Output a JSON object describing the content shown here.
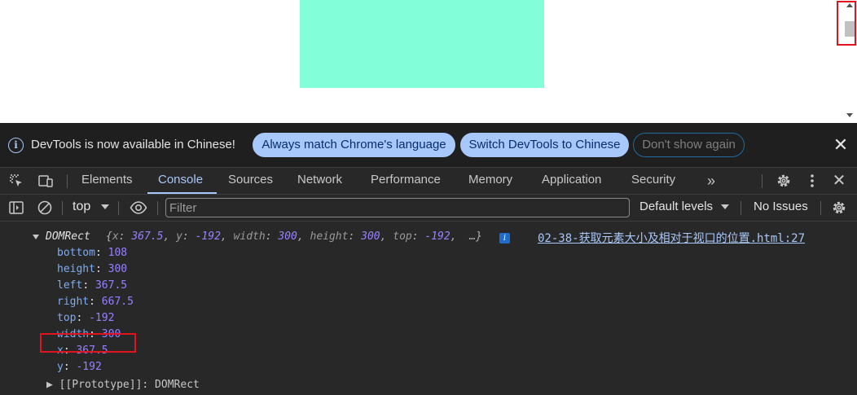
{
  "page": {
    "box_color": "#82ffd9"
  },
  "infobar": {
    "message": "DevTools is now available in Chinese!",
    "match_button": "Always match Chrome's language",
    "switch_button": "Switch DevTools to Chinese",
    "dismiss_button": "Don't show again"
  },
  "tabs": [
    {
      "label": "Elements"
    },
    {
      "label": "Console"
    },
    {
      "label": "Sources"
    },
    {
      "label": "Network"
    },
    {
      "label": "Performance"
    },
    {
      "label": "Memory"
    },
    {
      "label": "Application"
    },
    {
      "label": "Security"
    }
  ],
  "active_tab": "Console",
  "toolbar": {
    "context": "top",
    "filter_placeholder": "Filter",
    "levels": "Default levels",
    "issues": "No Issues"
  },
  "console": {
    "object_name": "DOMRect",
    "preview": {
      "x": "367.5",
      "y": "-192",
      "width": "300",
      "height": "300",
      "top": "-192"
    },
    "preview_ellipsis": "…}",
    "source": "02-38-获取元素大小及相对于视口的位置.html:27",
    "properties": [
      {
        "key": "bottom",
        "value": "108"
      },
      {
        "key": "height",
        "value": "300"
      },
      {
        "key": "left",
        "value": "367.5"
      },
      {
        "key": "right",
        "value": "667.5"
      },
      {
        "key": "top",
        "value": "-192"
      },
      {
        "key": "width",
        "value": "300"
      },
      {
        "key": "x",
        "value": "367.5"
      },
      {
        "key": "y",
        "value": "-192"
      }
    ],
    "prototype": "[[Prototype]]: DOMRect"
  },
  "colors": {
    "accent": "#a8c7fa",
    "highlight": "#e0141e",
    "number": "#9980ff"
  }
}
